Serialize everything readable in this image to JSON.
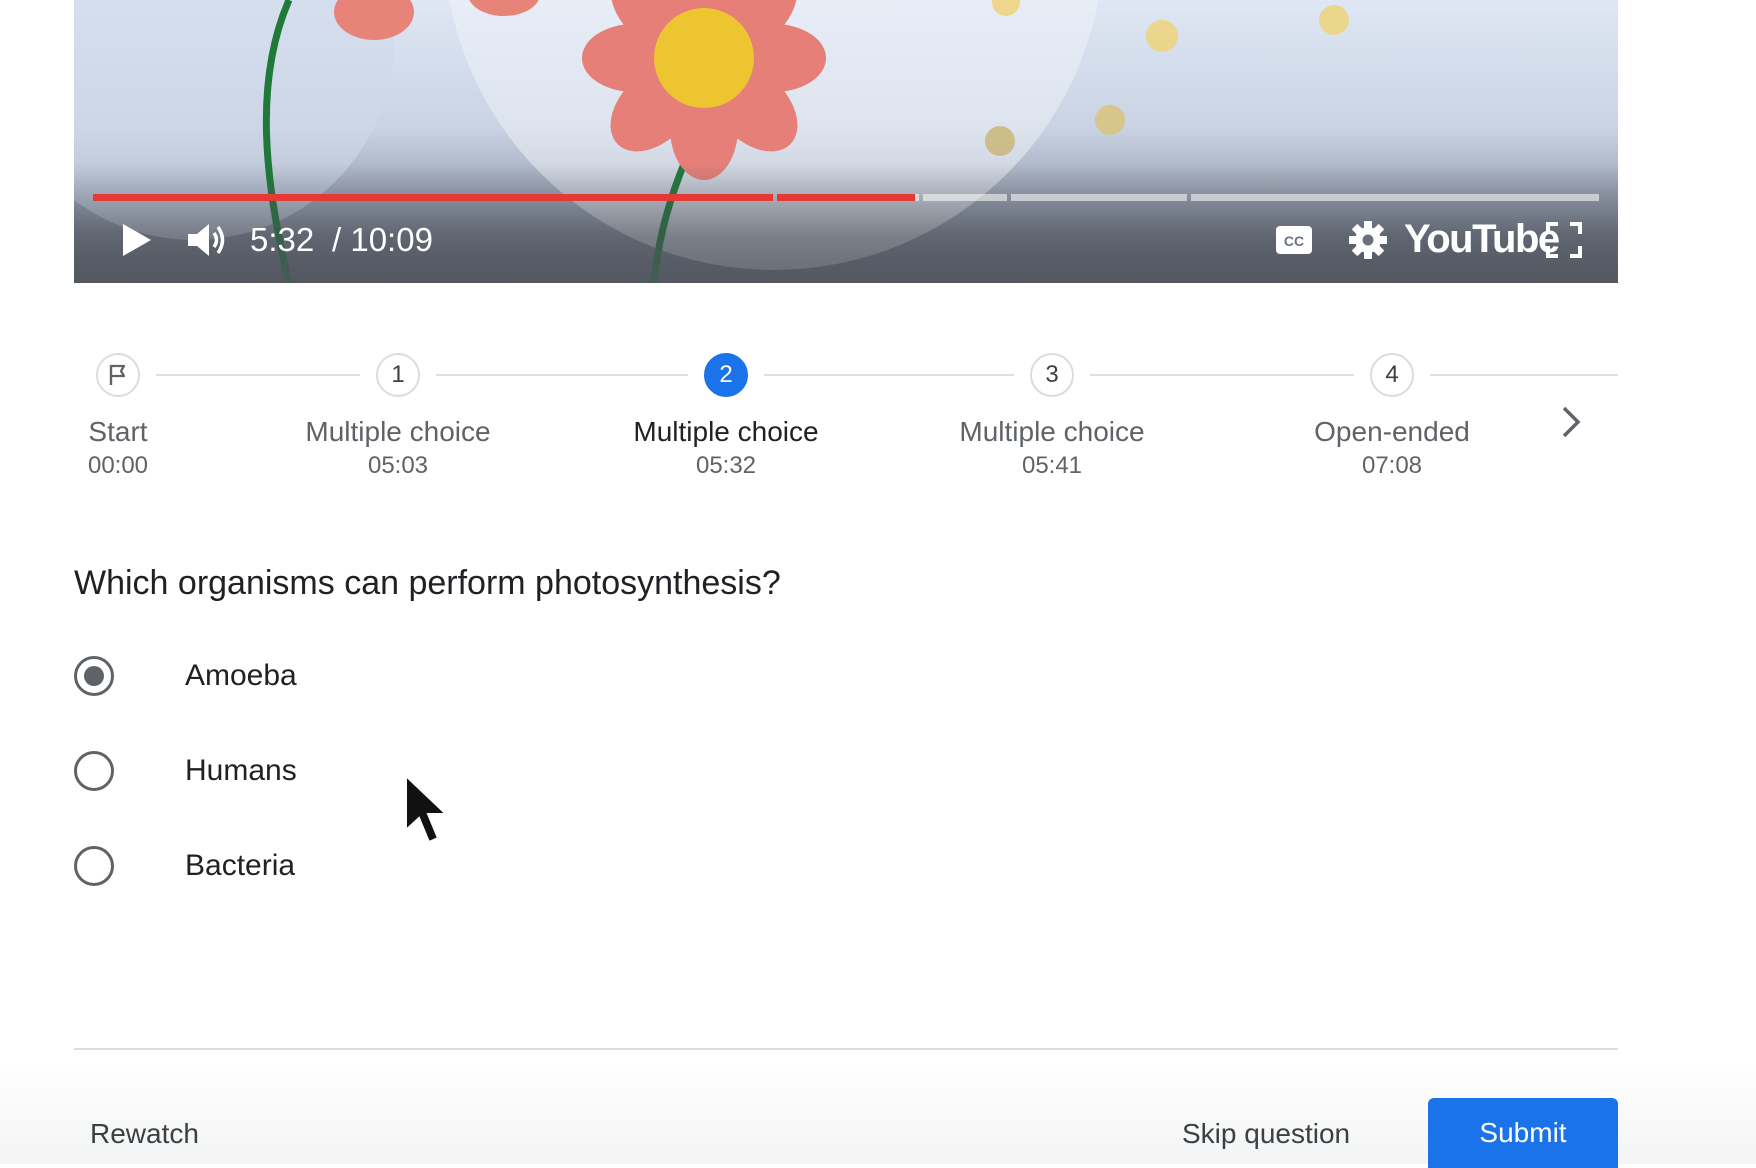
{
  "player": {
    "time_current": "5:32",
    "time_total": "/ 10:09",
    "brand": "YouTube",
    "progress_fraction": 0.546,
    "icons": [
      "play-icon",
      "volume-icon",
      "captions-icon",
      "settings-icon",
      "fullscreen-icon"
    ],
    "accent_color": "#e53935"
  },
  "timeline": {
    "steps": [
      {
        "marker": "",
        "label": "Start",
        "time": "00:00",
        "icon": "flag-icon"
      },
      {
        "marker": "1",
        "label": "Multiple choice",
        "time": "05:03"
      },
      {
        "marker": "2",
        "label": "Multiple choice",
        "time": "05:32",
        "active": true
      },
      {
        "marker": "3",
        "label": "Multiple choice",
        "time": "05:41"
      },
      {
        "marker": "4",
        "label": "Open-ended",
        "time": "07:08"
      }
    ],
    "active_color": "#1a73e8"
  },
  "question": {
    "text": "Which organisms can perform photosynthesis?",
    "options": [
      {
        "label": "Amoeba",
        "selected": true
      },
      {
        "label": "Humans",
        "selected": false
      },
      {
        "label": "Bacteria",
        "selected": false
      }
    ]
  },
  "actions": {
    "rewatch": "Rewatch",
    "skip": "Skip question",
    "submit": "Submit",
    "submit_color": "#1a73e8"
  }
}
